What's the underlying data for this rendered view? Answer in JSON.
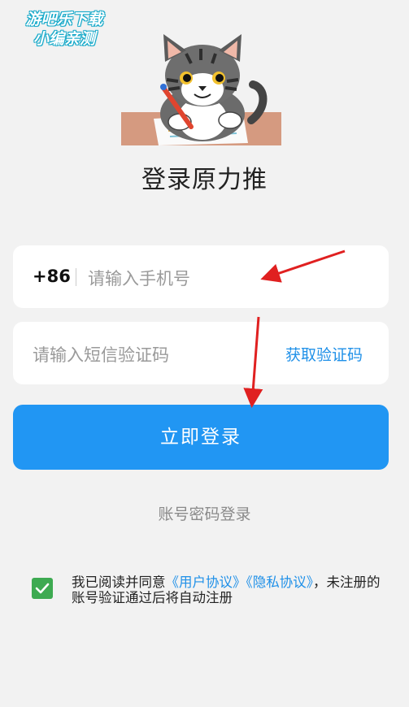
{
  "watermark": {
    "line1": "游吧乐下载",
    "line2": "小编亲测"
  },
  "title": "登录原力推",
  "phone": {
    "country_code": "+86",
    "placeholder": "请输入手机号"
  },
  "sms": {
    "placeholder": "请输入短信验证码",
    "get_code": "获取验证码"
  },
  "login_button": "立即登录",
  "password_login": "账号密码登录",
  "agreement": {
    "checked": true,
    "prefix": "我已阅读并同意",
    "user_agreement": "《用户协议》",
    "privacy_policy": "《隐私协议》",
    "suffix": "，未注册的账号验证通过后将自动注册"
  },
  "colors": {
    "primary": "#2196f3",
    "link": "#1f90e8",
    "check": "#3daa51",
    "arrow": "#e02020",
    "background": "#f2f2f2"
  }
}
